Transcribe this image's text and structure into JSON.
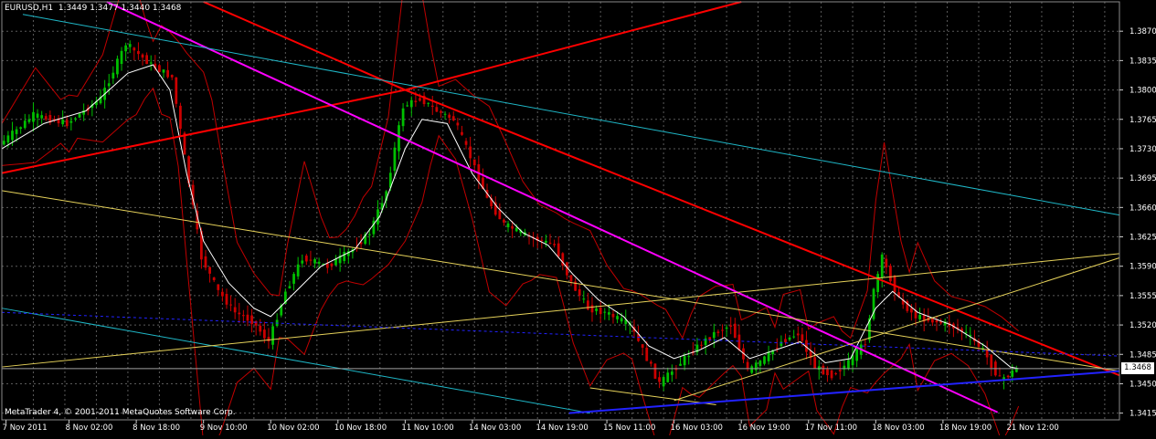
{
  "header": {
    "symbol": "EURUSD,H1",
    "ohlc": "1.3449 1.3477 1.3440 1.3468"
  },
  "footer": {
    "copyright": "MetaTrader 4, © 2001-2011 MetaQuotes Software Corp."
  },
  "colors": {
    "background": "#000000",
    "grid": "#5a5a5a",
    "bull_candle": "#00c000",
    "bear_candle": "#cc0000",
    "bands": "#c00000",
    "ma": "#ffffff",
    "red_line": "#ff0000",
    "magenta_line": "#ff00ff",
    "cyan_line": "#1fb8c8",
    "yellow_line": "#e6d25a",
    "blue_line": "#2222ff"
  },
  "chart_data": {
    "type": "candlestick",
    "ylim": [
      1.3407,
      1.3905
    ],
    "x_index_range": [
      0,
      266
    ],
    "y_ticks": [
      "1.3870",
      "1.3835",
      "1.3800",
      "1.3765",
      "1.3730",
      "1.3695",
      "1.3660",
      "1.3625",
      "1.3590",
      "1.3555",
      "1.3520",
      "1.3485",
      "1.3450",
      "1.3415"
    ],
    "x_ticks": [
      {
        "label": "7 Nov 2011",
        "i": 1
      },
      {
        "label": "8 Nov 02:00",
        "i": 16
      },
      {
        "label": "8 Nov 18:00",
        "i": 32
      },
      {
        "label": "9 Nov 10:00",
        "i": 48
      },
      {
        "label": "10 Nov 02:00",
        "i": 64
      },
      {
        "label": "10 Nov 18:00",
        "i": 80
      },
      {
        "label": "11 Nov 10:00",
        "i": 96
      },
      {
        "label": "14 Nov 03:00",
        "i": 112
      },
      {
        "label": "14 Nov 19:00",
        "i": 128
      },
      {
        "label": "15 Nov 11:00",
        "i": 144
      },
      {
        "label": "16 Nov 03:00",
        "i": 160
      },
      {
        "label": "16 Nov 19:00",
        "i": 176
      },
      {
        "label": "17 Nov 11:00",
        "i": 192
      },
      {
        "label": "18 Nov 03:00",
        "i": 208
      },
      {
        "label": "18 Nov 19:00",
        "i": 224
      },
      {
        "label": "21 Nov 12:00",
        "i": 240
      }
    ],
    "close_path": [
      [
        0,
        1.3735
      ],
      [
        8,
        1.377
      ],
      [
        16,
        1.376
      ],
      [
        24,
        1.379
      ],
      [
        30,
        1.3855
      ],
      [
        36,
        1.383
      ],
      [
        41,
        1.3815
      ],
      [
        44,
        1.372
      ],
      [
        48,
        1.36
      ],
      [
        52,
        1.356
      ],
      [
        56,
        1.3535
      ],
      [
        60,
        1.3525
      ],
      [
        64,
        1.35
      ],
      [
        68,
        1.356
      ],
      [
        72,
        1.36
      ],
      [
        78,
        1.359
      ],
      [
        84,
        1.361
      ],
      [
        88,
        1.363
      ],
      [
        92,
        1.368
      ],
      [
        96,
        1.378
      ],
      [
        100,
        1.379
      ],
      [
        104,
        1.3775
      ],
      [
        108,
        1.3765
      ],
      [
        112,
        1.372
      ],
      [
        116,
        1.367
      ],
      [
        120,
        1.364
      ],
      [
        126,
        1.3625
      ],
      [
        132,
        1.3615
      ],
      [
        136,
        1.357
      ],
      [
        140,
        1.354
      ],
      [
        144,
        1.3535
      ],
      [
        150,
        1.352
      ],
      [
        154,
        1.348
      ],
      [
        157,
        1.345
      ],
      [
        161,
        1.347
      ],
      [
        165,
        1.349
      ],
      [
        170,
        1.351
      ],
      [
        174,
        1.352
      ],
      [
        178,
        1.3465
      ],
      [
        182,
        1.348
      ],
      [
        186,
        1.35
      ],
      [
        190,
        1.351
      ],
      [
        194,
        1.347
      ],
      [
        198,
        1.346
      ],
      [
        202,
        1.3475
      ],
      [
        206,
        1.35
      ],
      [
        208,
        1.356
      ],
      [
        210,
        1.36
      ],
      [
        214,
        1.355
      ],
      [
        218,
        1.353
      ],
      [
        222,
        1.3525
      ],
      [
        226,
        1.352
      ],
      [
        230,
        1.351
      ],
      [
        234,
        1.349
      ],
      [
        238,
        1.3455
      ],
      [
        240,
        1.346
      ],
      [
        242,
        1.3468
      ]
    ],
    "ma_path": [
      [
        0,
        1.373
      ],
      [
        10,
        1.376
      ],
      [
        20,
        1.3775
      ],
      [
        30,
        1.382
      ],
      [
        36,
        1.383
      ],
      [
        40,
        1.38
      ],
      [
        44,
        1.37
      ],
      [
        48,
        1.362
      ],
      [
        54,
        1.357
      ],
      [
        60,
        1.354
      ],
      [
        64,
        1.353
      ],
      [
        70,
        1.356
      ],
      [
        76,
        1.359
      ],
      [
        84,
        1.361
      ],
      [
        90,
        1.365
      ],
      [
        96,
        1.373
      ],
      [
        100,
        1.3765
      ],
      [
        106,
        1.376
      ],
      [
        112,
        1.37
      ],
      [
        118,
        1.366
      ],
      [
        124,
        1.363
      ],
      [
        130,
        1.3615
      ],
      [
        136,
        1.358
      ],
      [
        142,
        1.355
      ],
      [
        148,
        1.353
      ],
      [
        154,
        1.3495
      ],
      [
        160,
        1.348
      ],
      [
        166,
        1.349
      ],
      [
        172,
        1.3505
      ],
      [
        178,
        1.348
      ],
      [
        184,
        1.349
      ],
      [
        190,
        1.35
      ],
      [
        196,
        1.3475
      ],
      [
        202,
        1.348
      ],
      [
        208,
        1.354
      ],
      [
        212,
        1.356
      ],
      [
        218,
        1.3535
      ],
      [
        226,
        1.352
      ],
      [
        234,
        1.3495
      ],
      [
        240,
        1.347
      ],
      [
        242,
        1.3468
      ]
    ],
    "lines": [
      {
        "color": "red_line",
        "width": 2,
        "points": [
          [
            0,
            1.3701
          ],
          [
            96,
            1.38
          ],
          [
            176,
            1.3905
          ]
        ]
      },
      {
        "color": "red_line",
        "width": 2,
        "points": [
          [
            48,
            1.3905
          ],
          [
            96,
            1.38
          ],
          [
            266,
            1.346
          ]
        ]
      },
      {
        "color": "magenta_line",
        "width": 2,
        "points": [
          [
            25,
            1.3905
          ],
          [
            237,
            1.3416
          ]
        ]
      },
      {
        "color": "cyan_line",
        "width": 1,
        "points": [
          [
            5,
            1.389
          ],
          [
            266,
            1.3651
          ]
        ]
      },
      {
        "color": "cyan_line",
        "width": 1,
        "points": [
          [
            0,
            1.354
          ],
          [
            140,
            1.3415
          ]
        ]
      },
      {
        "color": "yellow_line",
        "width": 1,
        "points": [
          [
            0,
            1.368
          ],
          [
            266,
            1.3465
          ]
        ]
      },
      {
        "color": "yellow_line",
        "width": 1,
        "points": [
          [
            0,
            1.347
          ],
          [
            266,
            1.3605
          ]
        ]
      },
      {
        "color": "yellow_line",
        "width": 1,
        "points": [
          [
            160,
            1.343
          ],
          [
            266,
            1.36
          ]
        ]
      },
      {
        "color": "yellow_line",
        "width": 1,
        "points": [
          [
            140,
            1.3445
          ],
          [
            170,
            1.3425
          ]
        ]
      },
      {
        "color": "blue_line",
        "width": 2,
        "points": [
          [
            135,
            1.3415
          ],
          [
            266,
            1.3465
          ]
        ]
      },
      {
        "color": "blue_line",
        "width": 1,
        "dashed": true,
        "points": [
          [
            0,
            1.3535
          ],
          [
            266,
            1.3483
          ]
        ]
      }
    ],
    "bid_line": 1.3468,
    "bid_label": "1.3468"
  }
}
